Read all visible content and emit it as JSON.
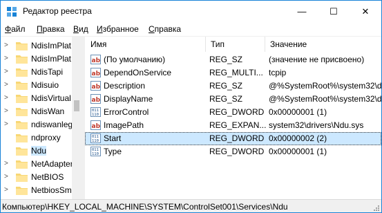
{
  "window": {
    "title": "Редактор реестра",
    "controls": {
      "minimize": "—",
      "maximize": "☐",
      "close": "✕"
    }
  },
  "menu": [
    {
      "first": "Ф",
      "rest": "айл"
    },
    {
      "first": "П",
      "rest": "равка"
    },
    {
      "first": "В",
      "rest": "ид"
    },
    {
      "first": "И",
      "rest": "збранное"
    },
    {
      "first": "С",
      "rest": "правка"
    }
  ],
  "tree": {
    "items": [
      {
        "label": "NdisImPlat",
        "expander": ">"
      },
      {
        "label": "NdisImPlat",
        "expander": ">"
      },
      {
        "label": "NdisTapi",
        "expander": ">"
      },
      {
        "label": "Ndisuio",
        "expander": ">"
      },
      {
        "label": "NdisVirtual",
        "expander": ">"
      },
      {
        "label": "NdisWan",
        "expander": ">"
      },
      {
        "label": "ndiswanleg",
        "expander": ">"
      },
      {
        "label": "ndproxy",
        "expander": ""
      },
      {
        "label": "Ndu",
        "expander": "",
        "selected": true
      },
      {
        "label": "NetAdapter",
        "expander": ">"
      },
      {
        "label": "NetBIOS",
        "expander": ">"
      },
      {
        "label": "NetbiosSm",
        "expander": ">"
      }
    ]
  },
  "columns": {
    "name": "Имя",
    "type": "Тип",
    "data": "Значение"
  },
  "values": [
    {
      "icon": "string-value-icon",
      "name": "(По умолчанию)",
      "type": "REG_SZ",
      "data": "(значение не присвоено)"
    },
    {
      "icon": "string-value-icon",
      "name": "DependOnService",
      "type": "REG_MULTI...",
      "data": "tcpip"
    },
    {
      "icon": "string-value-icon",
      "name": "Description",
      "type": "REG_SZ",
      "data": "@%SystemRoot%\\system32\\d"
    },
    {
      "icon": "string-value-icon",
      "name": "DisplayName",
      "type": "REG_SZ",
      "data": "@%SystemRoot%\\system32\\d"
    },
    {
      "icon": "binary-value-icon",
      "name": "ErrorControl",
      "type": "REG_DWORD",
      "data": "0x00000001 (1)"
    },
    {
      "icon": "string-value-icon",
      "name": "ImagePath",
      "type": "REG_EXPAN...",
      "data": "system32\\drivers\\Ndu.sys"
    },
    {
      "icon": "binary-value-icon",
      "name": "Start",
      "type": "REG_DWORD",
      "data": "0x00000002 (2)",
      "selected": true
    },
    {
      "icon": "binary-value-icon",
      "name": "Type",
      "type": "REG_DWORD",
      "data": "0x00000001 (1)"
    }
  ],
  "status": {
    "path": "Компьютер\\HKEY_LOCAL_MACHINE\\SYSTEM\\ControlSet001\\Services\\Ndu"
  },
  "colors": {
    "accent": "#1883d7",
    "selection": "#cce8ff",
    "folder": "#f8d775"
  }
}
